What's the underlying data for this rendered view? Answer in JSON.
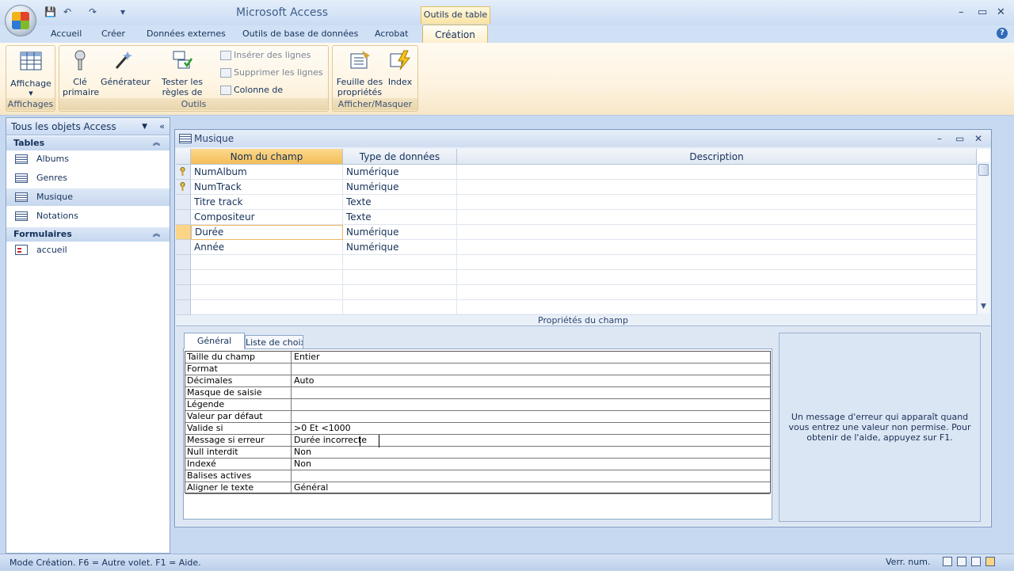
{
  "window": {
    "title": "Microsoft Access",
    "context_tab_group": "Outils de table"
  },
  "qat": {
    "save": "💾",
    "undo": "↶",
    "redo": "↷",
    "customize": "▾"
  },
  "tabs": [
    "Accueil",
    "Créer",
    "Données externes",
    "Outils de base de données",
    "Acrobat"
  ],
  "active_tab": "Création",
  "ribbon": {
    "affichage": {
      "button": "Affichage",
      "group": "Affichages"
    },
    "outils": {
      "cle": "Clé primaire",
      "generateur": "Générateur",
      "tester": "Tester les règles de validation",
      "inserer": "Insérer des lignes",
      "supprimer": "Supprimer les lignes",
      "colonne": "Colonne de recherche",
      "group": "Outils"
    },
    "afficher": {
      "feuille": "Feuille des propriétés",
      "index": "Index",
      "group": "Afficher/Masquer"
    }
  },
  "nav": {
    "header": "Tous les objets Access",
    "tables_label": "Tables",
    "tables": [
      "Albums",
      "Genres",
      "Musique",
      "Notations"
    ],
    "forms_label": "Formulaires",
    "forms": [
      "accueil"
    ]
  },
  "doc": {
    "title": "Musique",
    "columns": [
      "Nom du champ",
      "Type de données",
      "Description"
    ],
    "rows": [
      {
        "name": "NumAlbum",
        "type": "Numérique",
        "key": true
      },
      {
        "name": "NumTrack",
        "type": "Numérique",
        "key": true
      },
      {
        "name": "Titre track",
        "type": "Texte",
        "key": false
      },
      {
        "name": "Compositeur",
        "type": "Texte",
        "key": false
      },
      {
        "name": "Durée",
        "type": "Numérique",
        "key": false
      },
      {
        "name": "Année",
        "type": "Numérique",
        "key": false
      }
    ]
  },
  "props": {
    "label": "Propriétés du champ",
    "tab_general": "Général",
    "tab_liste": "Liste de choix",
    "rows": [
      {
        "label": "Taille du champ",
        "value": "Entier"
      },
      {
        "label": "Format",
        "value": ""
      },
      {
        "label": "Décimales",
        "value": "Auto"
      },
      {
        "label": "Masque de saisie",
        "value": ""
      },
      {
        "label": "Légende",
        "value": ""
      },
      {
        "label": "Valeur par défaut",
        "value": ""
      },
      {
        "label": "Valide si",
        "value": ">0 Et <1000"
      },
      {
        "label": "Message si erreur",
        "value": "Durée incorrecte"
      },
      {
        "label": "Null interdit",
        "value": "Non"
      },
      {
        "label": "Indexé",
        "value": "Non"
      },
      {
        "label": "Balises actives",
        "value": ""
      },
      {
        "label": "Aligner le texte",
        "value": "Général"
      }
    ],
    "help": "Un message d'erreur qui apparaît quand vous entrez une valeur non permise. Pour obtenir de l'aide, appuyez sur F1."
  },
  "status": {
    "left": "Mode Création. F6 = Autre volet. F1 = Aide.",
    "right": "Verr. num."
  }
}
